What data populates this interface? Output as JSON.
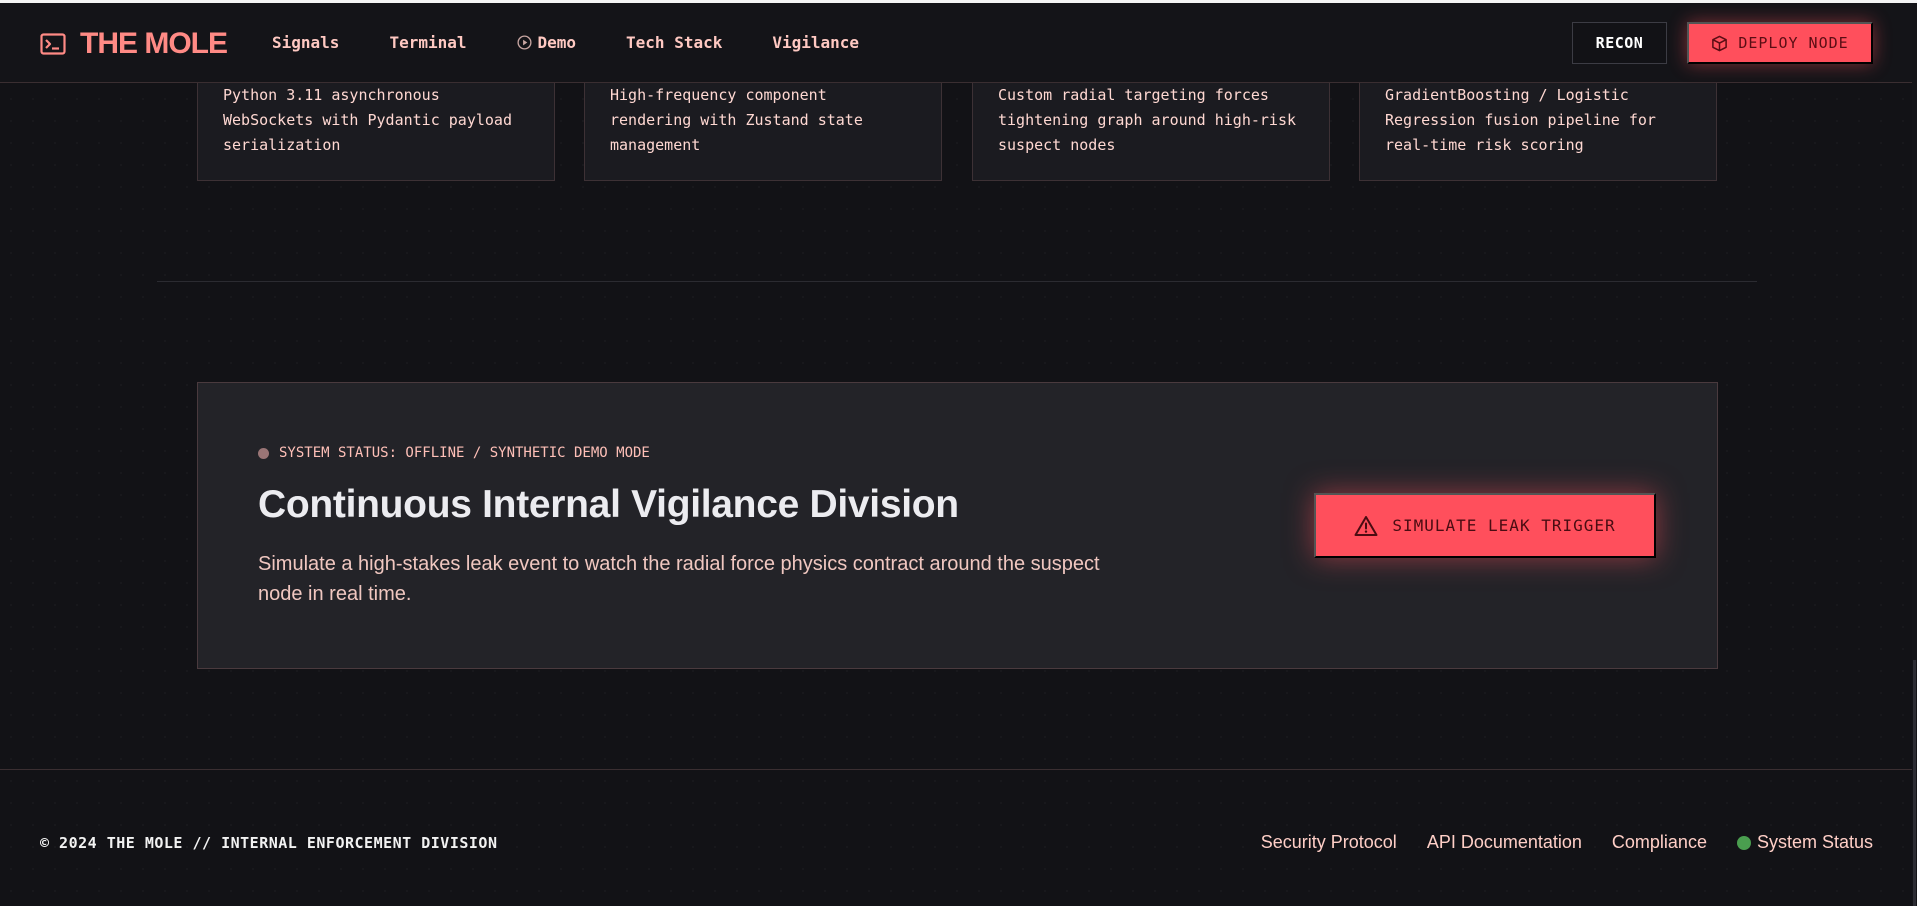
{
  "nav": {
    "brand": "THE MOLE",
    "links": [
      {
        "label": "Signals"
      },
      {
        "label": "Terminal"
      },
      {
        "label": "Demo",
        "icon": "play-circle-icon"
      },
      {
        "label": "Tech Stack"
      },
      {
        "label": "Vigilance"
      }
    ],
    "recon_label": "RECON",
    "deploy_label": "DEPLOY NODE"
  },
  "tech_cards": [
    {
      "text": "Python 3.11 asynchronous WebSockets with Pydantic payload serialization"
    },
    {
      "text": "High-frequency component rendering with Zustand state management"
    },
    {
      "text": "Custom radial targeting forces tightening graph around high-risk suspect nodes"
    },
    {
      "text": "GradientBoosting / Logistic Regression fusion pipeline for real-time risk scoring"
    }
  ],
  "vigilance": {
    "status": "SYSTEM STATUS: OFFLINE / SYNTHETIC DEMO MODE",
    "title": "Continuous Internal Vigilance Division",
    "description": "Simulate a high-stakes leak event to watch the radial force physics contract around the suspect node in real time.",
    "button_label": "SIMULATE LEAK TRIGGER"
  },
  "footer": {
    "copyright": "© 2024 THE MOLE // INTERNAL ENFORCEMENT DIVISION",
    "links": [
      "Security Protocol",
      "API Documentation",
      "Compliance"
    ],
    "status_label": "System Status"
  },
  "colors": {
    "accent": "#ff4f5c",
    "brand": "#ff8a85",
    "background": "#121216",
    "status_online": "#4a9e4f"
  }
}
